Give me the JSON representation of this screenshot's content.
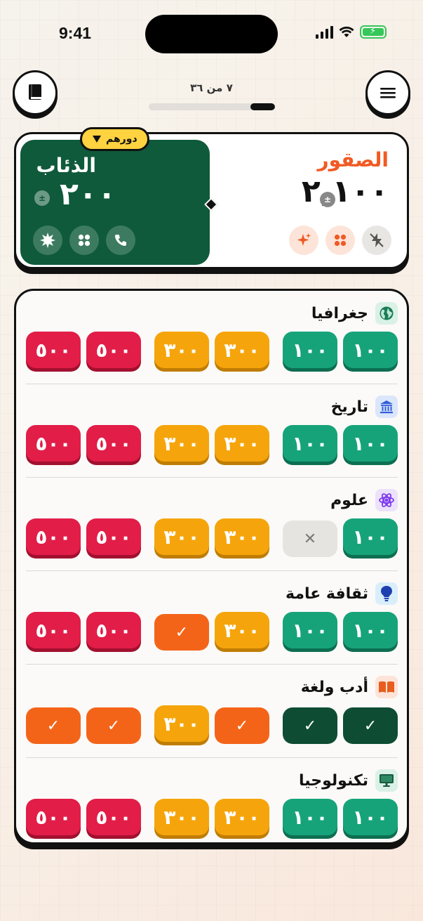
{
  "status": {
    "time": "9:41"
  },
  "progress": {
    "label": "٧ من ٣٦",
    "fraction": 0.194
  },
  "teams": {
    "active": {
      "name": "الذئاب",
      "score": "٢٠٠",
      "turn_label": "دورهم",
      "color": "#0f5a3b"
    },
    "other": {
      "name": "الصقور",
      "score": "٢,١٠٠",
      "color": "#f15a24"
    }
  },
  "pm_symbol": "±",
  "categories": [
    {
      "title": "جغرافيا",
      "icon": "globe-icon",
      "icon_bg": "#d9f1e6",
      "tiles": [
        {
          "label": "٥٠٠",
          "state": "red"
        },
        {
          "label": "٥٠٠",
          "state": "red"
        },
        {
          "label": "٣٠٠",
          "state": "yellow"
        },
        {
          "label": "٣٠٠",
          "state": "yellow"
        },
        {
          "label": "١٠٠",
          "state": "green"
        },
        {
          "label": "١٠٠",
          "state": "green"
        }
      ]
    },
    {
      "title": "تاريخ",
      "icon": "museum-icon",
      "icon_bg": "#dbe6fb",
      "tiles": [
        {
          "label": "٥٠٠",
          "state": "red"
        },
        {
          "label": "٥٠٠",
          "state": "red"
        },
        {
          "label": "٣٠٠",
          "state": "yellow"
        },
        {
          "label": "٣٠٠",
          "state": "yellow"
        },
        {
          "label": "١٠٠",
          "state": "green"
        },
        {
          "label": "١٠٠",
          "state": "green"
        }
      ]
    },
    {
      "title": "علوم",
      "icon": "atom-icon",
      "icon_bg": "#ece2fb",
      "tiles": [
        {
          "label": "٥٠٠",
          "state": "red"
        },
        {
          "label": "٥٠٠",
          "state": "red"
        },
        {
          "label": "٣٠٠",
          "state": "yellow"
        },
        {
          "label": "٣٠٠",
          "state": "yellow"
        },
        {
          "label": "✕",
          "state": "empty"
        },
        {
          "label": "١٠٠",
          "state": "green"
        }
      ]
    },
    {
      "title": "ثقافة عامة",
      "icon": "lightbulb-icon",
      "icon_bg": "#d9eefb",
      "tiles": [
        {
          "label": "٥٠٠",
          "state": "red"
        },
        {
          "label": "٥٠٠",
          "state": "red"
        },
        {
          "label": "✓",
          "state": "orange-done"
        },
        {
          "label": "٣٠٠",
          "state": "yellow"
        },
        {
          "label": "١٠٠",
          "state": "green"
        },
        {
          "label": "١٠٠",
          "state": "green"
        }
      ]
    },
    {
      "title": "أدب ولغة",
      "icon": "open-book-icon",
      "icon_bg": "#fde4d8",
      "tiles": [
        {
          "label": "✓",
          "state": "orange-done"
        },
        {
          "label": "✓",
          "state": "orange-done"
        },
        {
          "label": "٣٠٠",
          "state": "yellow"
        },
        {
          "label": "✓",
          "state": "orange-done"
        },
        {
          "label": "✓",
          "state": "green-done"
        },
        {
          "label": "✓",
          "state": "green-done"
        }
      ]
    },
    {
      "title": "تكنولوجيا",
      "icon": "monitor-icon",
      "icon_bg": "#d9f1e6",
      "tiles": [
        {
          "label": "٥٠٠",
          "state": "red"
        },
        {
          "label": "٥٠٠",
          "state": "red"
        },
        {
          "label": "٣٠٠",
          "state": "yellow"
        },
        {
          "label": "٣٠٠",
          "state": "yellow"
        },
        {
          "label": "١٠٠",
          "state": "green"
        },
        {
          "label": "١٠٠",
          "state": "green"
        }
      ]
    }
  ],
  "colors": {
    "accent_orange": "#f15a24",
    "turn_yellow": "#ffd23f",
    "tile_red": "#e11d48",
    "tile_yellow": "#f5a50b",
    "tile_green": "#16a37a"
  }
}
